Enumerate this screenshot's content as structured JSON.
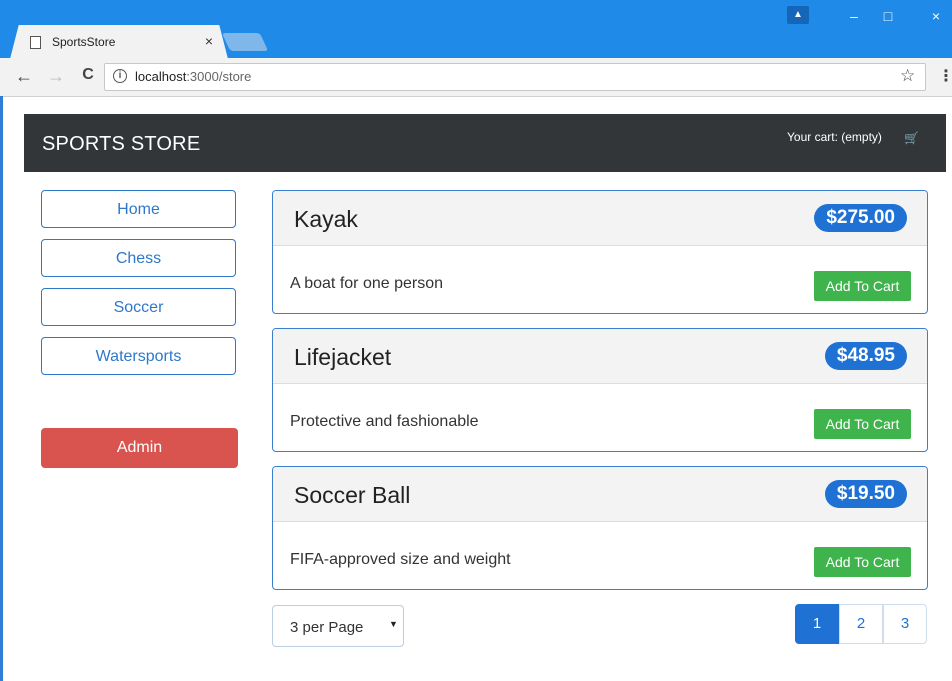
{
  "browser": {
    "tab_title": "SportsStore",
    "tab_close": "×",
    "url_host": "localhost",
    "url_path": ":3000/store",
    "nav": {
      "back": "←",
      "forward": "→",
      "reload": "C"
    },
    "window_controls": {
      "minimize": "–",
      "maximize": "□",
      "close": "×"
    },
    "profile_icon": "▲",
    "star_icon": "☆",
    "menu_icon": "⋮",
    "info_icon": "i"
  },
  "navbar": {
    "brand": "SPORTS STORE",
    "cart_summary": "Your cart: (empty)",
    "cart_icon": "🛒"
  },
  "categories": [
    "Home",
    "Chess",
    "Soccer",
    "Watersports"
  ],
  "admin_label": "Admin",
  "products": [
    {
      "name": "Kayak",
      "price": "$275.00",
      "description": "A boat for one person",
      "button": "Add To Cart"
    },
    {
      "name": "Lifejacket",
      "price": "$48.95",
      "description": "Protective and fashionable",
      "button": "Add To Cart"
    },
    {
      "name": "Soccer Ball",
      "price": "$19.50",
      "description": "FIFA-approved size and weight",
      "button": "Add To Cart"
    }
  ],
  "pagination": {
    "per_page_label": "3 per Page",
    "caret": "▼",
    "pages": [
      "1",
      "2",
      "3"
    ],
    "active_page": "1"
  },
  "colors": {
    "chrome_blue": "#1f8ae8",
    "navbar_dark": "#333639",
    "primary": "#1f72d4",
    "danger": "#d9534f",
    "success": "#3fb44d"
  }
}
